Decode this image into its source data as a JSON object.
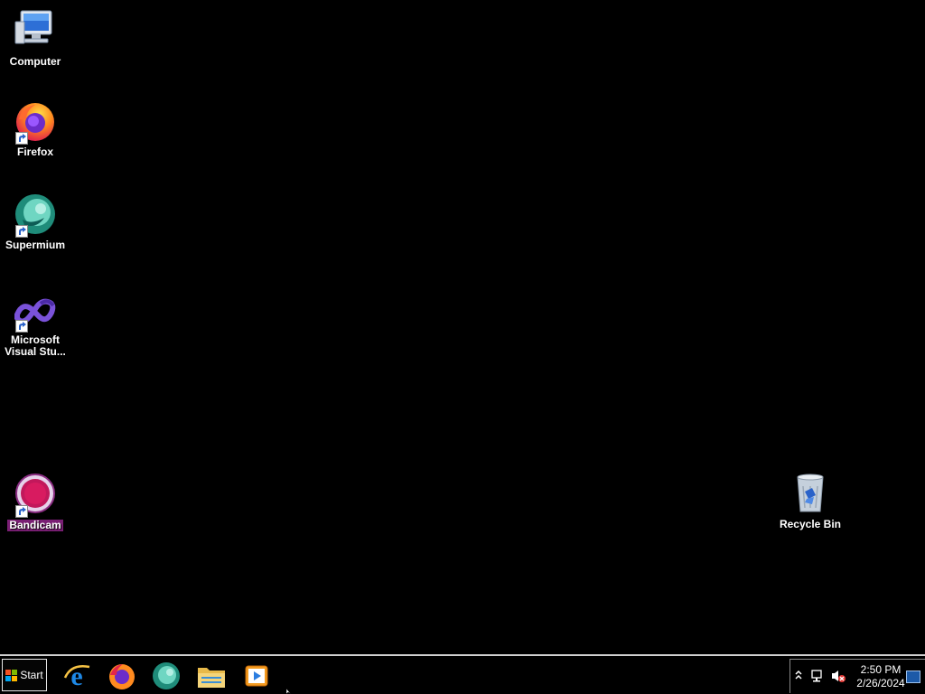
{
  "desktop": {
    "icons": [
      {
        "label": "Computer"
      },
      {
        "label": "Firefox"
      },
      {
        "label": "Supermium"
      },
      {
        "label": "Microsoft Visual Stu..."
      },
      {
        "label": "Bandicam"
      },
      {
        "label": "Recycle Bin"
      }
    ]
  },
  "taskbar": {
    "start_label": "Start",
    "pinned": [
      "internet-explorer-icon",
      "firefox-icon",
      "supermium-icon",
      "file-explorer-icon",
      "media-player-icon"
    ]
  },
  "tray": {
    "time": "2:50 PM",
    "date": "2/26/2024"
  },
  "colors": {
    "desktop_bg": "#000000",
    "selection": "#7a1f74"
  }
}
